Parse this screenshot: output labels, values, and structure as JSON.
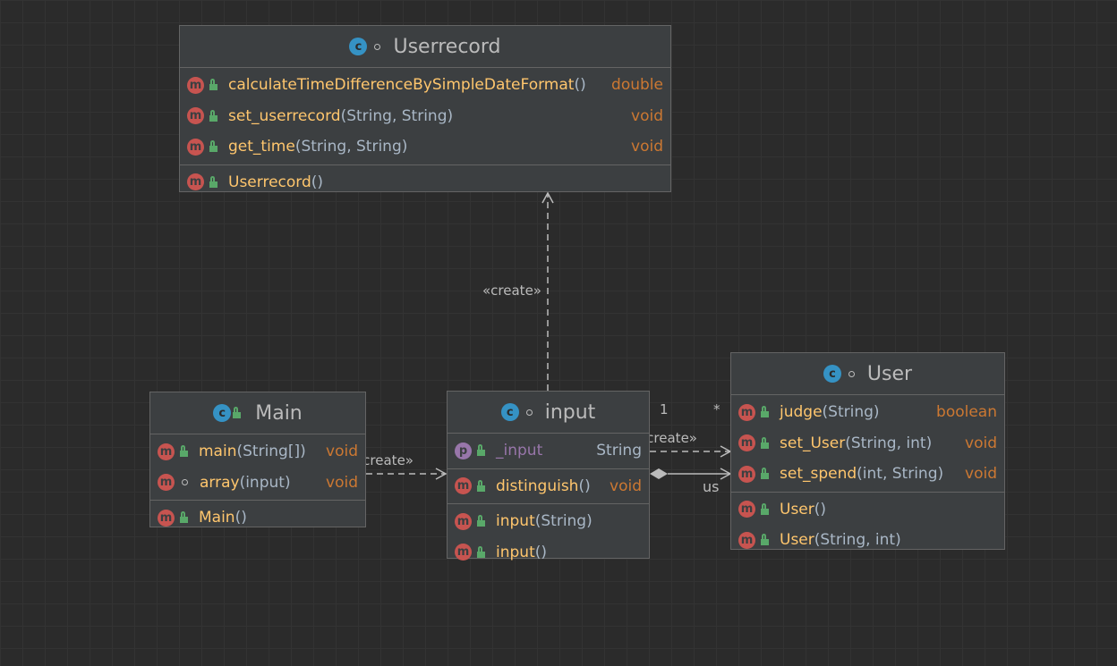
{
  "stereotype_create": "«create»",
  "multiplicity_one": "1",
  "multiplicity_many": "*",
  "association_role": "us",
  "class_badge": "c",
  "method_badge": "m",
  "field_badge": "p",
  "classes": {
    "userrecord": {
      "name": "Userrecord",
      "methods": [
        {
          "name": "calculateTimeDifferenceBySimpleDateFormat",
          "params": " ()",
          "ret": "double"
        },
        {
          "name": "set_userrecord",
          "params": " (String, String)",
          "ret": "void"
        },
        {
          "name": "get_time",
          "params": "(String, String)",
          "ret": "void"
        }
      ],
      "constructors": [
        {
          "name": "Userrecord",
          "params": " ()"
        }
      ]
    },
    "main": {
      "name": "Main",
      "methods": [
        {
          "name": "main",
          "params": "(String[])",
          "ret": "void"
        },
        {
          "name": "array",
          "params": "(input)",
          "ret": "void"
        }
      ],
      "constructors": [
        {
          "name": "Main",
          "params": "()"
        }
      ]
    },
    "input": {
      "name": "input",
      "fields": [
        {
          "name": "_input",
          "type": "String"
        }
      ],
      "methods": [
        {
          "name": "distinguish",
          "params": "()",
          "ret": "void"
        }
      ],
      "constructors": [
        {
          "name": "input",
          "params": "(String)"
        },
        {
          "name": "input",
          "params": "()"
        }
      ]
    },
    "user": {
      "name": "User",
      "methods": [
        {
          "name": "judge",
          "params": "(String)",
          "ret": "boolean"
        },
        {
          "name": "set_User",
          "params": " (String, int)",
          "ret": "void"
        },
        {
          "name": "set_spend",
          "params": " (int, String)",
          "ret": "void"
        }
      ],
      "constructors": [
        {
          "name": "User",
          "params": " ()"
        },
        {
          "name": "User",
          "params": " (String, int)"
        }
      ]
    }
  }
}
